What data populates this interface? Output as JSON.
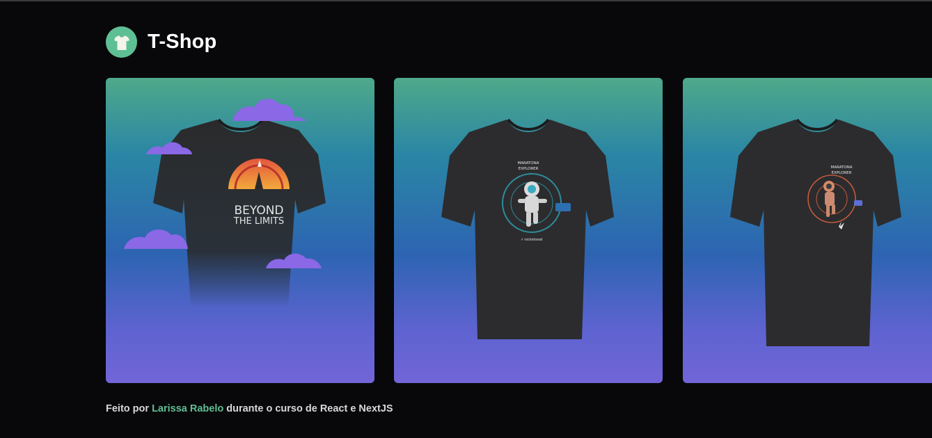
{
  "header": {
    "logo_icon": "t-shirt-icon",
    "brand": "T-Shop"
  },
  "colors": {
    "background": "#08080a",
    "accent": "#5fbf94",
    "shirt": "#2c2c2e"
  },
  "products": [
    {
      "design": "beyond-the-limits",
      "print_line1": "BEYOND",
      "print_line2": "THE LIMITS"
    },
    {
      "design": "maratona-explorer-blue",
      "print_line1": "MARATONA",
      "print_line2": "EXPLORER"
    },
    {
      "design": "maratona-explorer-orange",
      "print_line1": "MARATONA",
      "print_line2": "EXPLORER"
    }
  ],
  "footer": {
    "prefix": "Feito por",
    "author": "Larissa Rabelo",
    "suffix": "durante o curso de React e NextJS"
  }
}
